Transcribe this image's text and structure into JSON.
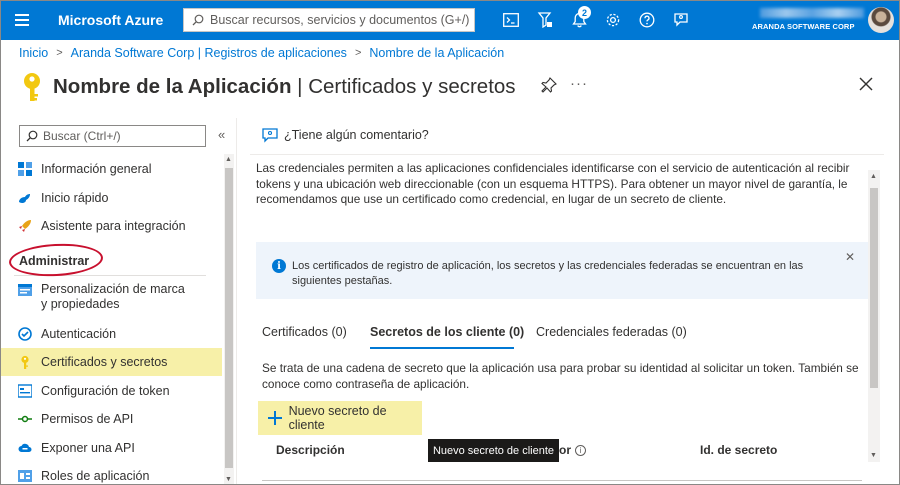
{
  "topbar": {
    "brand": "Microsoft Azure",
    "search_placeholder": "Buscar recursos, servicios y documentos (G+/)",
    "notification_count": "2",
    "organization": "ARANDA SOFTWARE CORP",
    "icons": [
      "terminal-icon",
      "filter-icon",
      "bell-icon",
      "gear-icon",
      "help-icon",
      "feedback-icon"
    ]
  },
  "breadcrumb": [
    "Inicio",
    "Aranda Software Corp | Registros de aplicaciones",
    "Nombre de la Aplicación"
  ],
  "page": {
    "title_main": "Nombre de la Aplicación",
    "title_sep": " | ",
    "title_sub": "Certificados y secretos",
    "more": "···"
  },
  "nav": {
    "search_placeholder": "Buscar (Ctrl+/)",
    "collapse": "«",
    "items_top": [
      {
        "label": "Información general",
        "icon": "overview-icon"
      },
      {
        "label": "Inicio rápido",
        "icon": "quickstart-icon"
      },
      {
        "label": "Asistente para integración",
        "icon": "rocket-icon"
      }
    ],
    "section": "Administrar",
    "items_manage": [
      {
        "label": "Personalización de marca y propiedades",
        "icon": "branding-icon"
      },
      {
        "label": "Autenticación",
        "icon": "authentication-icon"
      },
      {
        "label": "Certificados y secretos",
        "icon": "key-icon"
      },
      {
        "label": "Configuración de token",
        "icon": "token-icon"
      },
      {
        "label": "Permisos de API",
        "icon": "api-permissions-icon"
      },
      {
        "label": "Exponer una API",
        "icon": "cloud-api-icon"
      },
      {
        "label": "Roles de aplicación",
        "icon": "app-roles-icon"
      }
    ]
  },
  "content": {
    "feedback": "¿Tiene algún comentario?",
    "intro": "Las credenciales permiten a las aplicaciones confidenciales identificarse con el servicio de autenticación al recibir tokens y una ubicación web direccionable (con un esquema HTTPS). Para obtener un mayor nivel de garantía, le recomendamos que use un certificado como credencial, en lugar de un secreto de cliente.",
    "info_banner": "Los certificados de registro de aplicación, los secretos y las credenciales federadas se encuentran en las siguientes pestañas.",
    "info_close": "✕",
    "tabs": [
      "Certificados (0)",
      "Secretos de los cliente (0)",
      "Credenciales federadas (0)"
    ],
    "description": "Se trata de una cadena de secreto que la aplicación usa para probar su identidad al solicitar un token. También se conoce como contraseña de aplicación.",
    "new_secret_button": "Nuevo secreto de cliente",
    "tooltip": "Nuevo secreto de cliente",
    "table_headers": {
      "description": "Descripción",
      "value_tail": "or",
      "secret_id": "Id. de secreto"
    }
  },
  "colors": {
    "azure_blue": "#0078d4",
    "highlight": "#f7f0a8",
    "annotation_red": "#c8102e"
  }
}
